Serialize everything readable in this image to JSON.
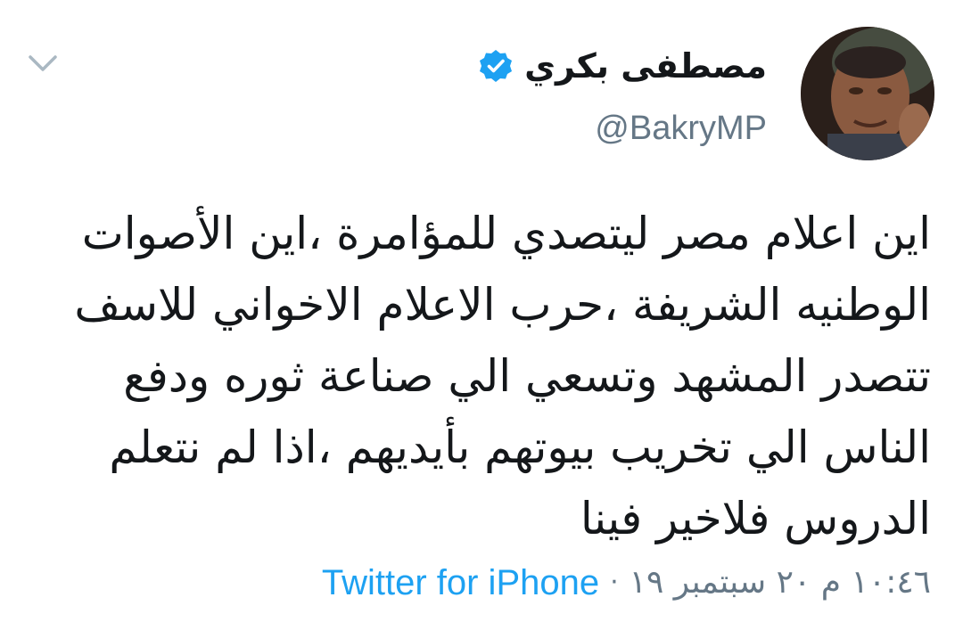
{
  "tweet": {
    "author": {
      "display_name": "مصطفى بكري",
      "handle": "@BakryMP",
      "verified": true
    },
    "text": "اين اعلام مصر ليتصدي للمؤامرة ،اين الأصوات\nالوطنيه الشريفة ،حرب الاعلام الاخواني للاسف\nتتصدر المشهد وتسعي الي صناعة ثوره ودفع\nالناس الي تخريب بيوتهم بأيديهم ،اذا لم نتعلم\nالدروس فلاخير فينا",
    "timestamp": "١٠:٤٦ م ٢٠ سبتمبر ١٩",
    "separator": "·",
    "source": "Twitter for iPhone"
  },
  "icons": {
    "verified": "verified-badge-icon",
    "caret": "chevron-down-icon"
  },
  "colors": {
    "verified_blue": "#1da1f2",
    "text_primary": "#14171a",
    "text_secondary": "#657786",
    "link": "#1da1f2",
    "caret_gray": "#aab8c2"
  }
}
